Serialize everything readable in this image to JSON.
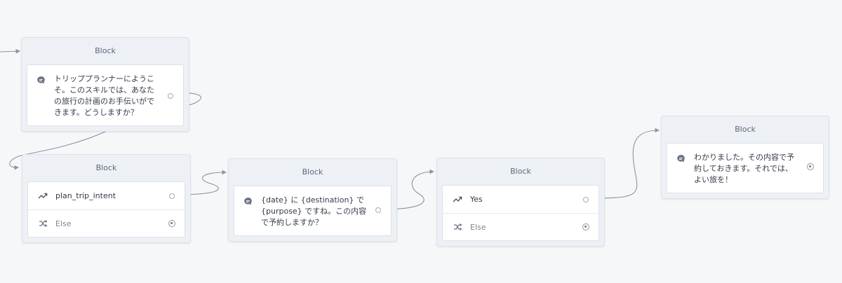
{
  "block_title": "Block",
  "blocks": [
    {
      "title": "Block",
      "message": "トリッププランナーにようこ\nそ。このスキルでは、あなた\nの旅行の計画のお手伝いがで\nきます。どうしますか？",
      "message_icon": "chat-bubble-icon"
    },
    {
      "title": "Block",
      "rows": [
        {
          "label": "plan_trip_intent",
          "icon": "intent-arrow-icon"
        },
        {
          "label": "Else",
          "icon": "shuffle-icon"
        }
      ]
    },
    {
      "title": "Block",
      "message": "{date} に {destination} で\n{purpose} ですね。この内容\nで予約しますか？",
      "message_icon": "chat-bubble-icon"
    },
    {
      "title": "Block",
      "rows": [
        {
          "label": "Yes",
          "icon": "intent-arrow-icon"
        },
        {
          "label": "Else",
          "icon": "shuffle-icon"
        }
      ]
    },
    {
      "title": "Block",
      "message": "わかりました。その内容で予\n約しておきます。それでは、\nよい旅を！",
      "message_icon": "chat-bubble-icon"
    }
  ],
  "colors": {
    "canvas": "#f6f7f8",
    "block_bg": "#edf0f5",
    "card_bg": "#ffffff",
    "wire": "#8b94a3"
  }
}
